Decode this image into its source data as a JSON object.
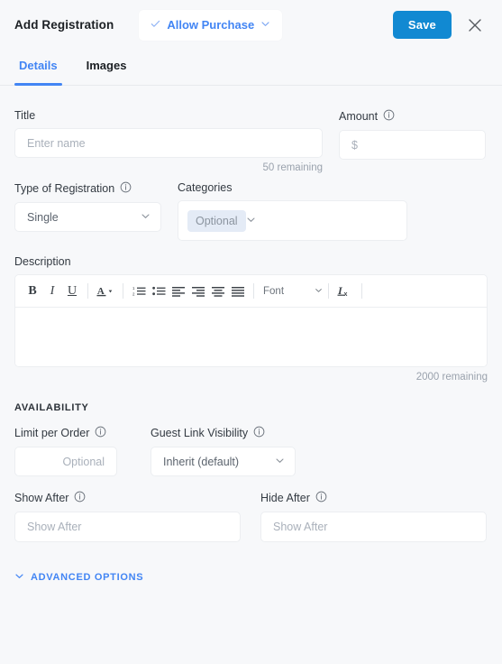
{
  "header": {
    "title": "Add Registration",
    "purchase_toggle": {
      "label": "Allow Purchase",
      "check_icon": "check-icon",
      "chevron_icon": "chevron-down-icon"
    },
    "save_label": "Save",
    "close_icon": "close-icon",
    "accent_blue": "#4285f4",
    "save_blue": "#1189d2"
  },
  "tabs": [
    {
      "label": "Details",
      "active": true
    },
    {
      "label": "Images",
      "active": false
    }
  ],
  "form": {
    "title": {
      "label": "Title",
      "placeholder": "Enter name",
      "value": "",
      "helper": "50 remaining"
    },
    "amount": {
      "label": "Amount",
      "info_icon": "info-icon",
      "placeholder": "$",
      "value": ""
    },
    "type_of_registration": {
      "label": "Type of Registration",
      "info_icon": "info-icon",
      "value": "Single",
      "chevron_icon": "chevron-down-icon"
    },
    "categories": {
      "label": "Categories",
      "chip": "Optional",
      "chevron_icon": "chevron-down-icon"
    },
    "description": {
      "label": "Description",
      "value": "",
      "helper": "2000 remaining",
      "toolbar": [
        {
          "name": "bold-icon",
          "glyph": "B"
        },
        {
          "name": "italic-icon",
          "glyph": "I"
        },
        {
          "name": "underline-icon",
          "glyph": "U"
        },
        {
          "name": "text-color-icon",
          "glyph": "A"
        },
        {
          "name": "ordered-list-icon",
          "glyph": ""
        },
        {
          "name": "unordered-list-icon",
          "glyph": ""
        },
        {
          "name": "align-left-icon",
          "glyph": ""
        },
        {
          "name": "align-right-icon",
          "glyph": ""
        },
        {
          "name": "align-center-icon",
          "glyph": ""
        },
        {
          "name": "align-justify-icon",
          "glyph": ""
        },
        {
          "name": "clear-formatting-icon",
          "glyph": ""
        }
      ],
      "font_label": "Font"
    }
  },
  "availability": {
    "group_label": "AVAILABILITY",
    "limit_per_order": {
      "label": "Limit per Order",
      "info_icon": "info-icon",
      "placeholder": "Optional",
      "value": ""
    },
    "guest_link_visibility": {
      "label": "Guest Link Visibility",
      "info_icon": "info-icon",
      "value": "Inherit (default)",
      "chevron_icon": "chevron-down-icon"
    },
    "show_after": {
      "label": "Show After",
      "info_icon": "info-icon",
      "placeholder": "Show After",
      "value": ""
    },
    "hide_after": {
      "label": "Hide After",
      "info_icon": "info-icon",
      "placeholder": "Show After",
      "value": ""
    }
  },
  "advanced_options": {
    "label": "ADVANCED OPTIONS",
    "chevron_icon": "chevron-down-icon"
  }
}
